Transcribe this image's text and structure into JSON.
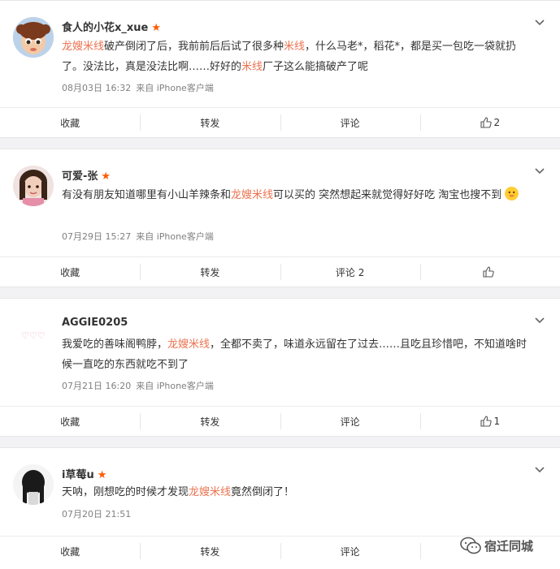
{
  "colors": {
    "highlight": "#eb7350",
    "star": "#ff5a00",
    "meta": "#808080"
  },
  "posts": [
    {
      "username": "食人的小花x_xue",
      "content": [
        {
          "t": "龙嫂米线",
          "hl": true
        },
        {
          "t": "破产倒闭了后，我前前后后试了很多种"
        },
        {
          "t": "米线",
          "hl": true
        },
        {
          "t": "，什么马老*，稻花*，都是买一包吃一袋就扔了。没法比，真是没法比啊……好好的"
        },
        {
          "t": "米线",
          "hl": true
        },
        {
          "t": "厂子这么能搞破产了呢"
        }
      ],
      "date": "08月03日 16:32",
      "source": "来自 iPhone客户端",
      "actions": {
        "collect": "收藏",
        "forward": "转发",
        "comment": "评论",
        "like_count": "2"
      }
    },
    {
      "username": "可爱-张",
      "content": [
        {
          "t": "有没有朋友知道哪里有小山羊辣条和"
        },
        {
          "t": "龙嫂米线",
          "hl": true
        },
        {
          "t": "可以买的 突然想起来就觉得好好吃 淘宝也搜不到 "
        }
      ],
      "emoji": "smile-emoji",
      "date": "07月29日 15:27",
      "source": "来自 iPhone客户端",
      "actions": {
        "collect": "收藏",
        "forward": "转发",
        "comment": "评论 2",
        "like_count": ""
      }
    },
    {
      "username": "AGGIE0205",
      "content": [
        {
          "t": "我爱吃的善味阁鸭脖，"
        },
        {
          "t": "龙嫂米线",
          "hl": true
        },
        {
          "t": "，全都不卖了，味道永远留在了过去……且吃且珍惜吧，不知道啥时候一直吃的东西就吃不到了"
        }
      ],
      "date": "07月21日 16:20",
      "source": "来自 iPhone客户端",
      "actions": {
        "collect": "收藏",
        "forward": "转发",
        "comment": "评论",
        "like_count": "1"
      }
    },
    {
      "username": "i草莓u",
      "content": [
        {
          "t": "天呐，刚想吃的时候才发现"
        },
        {
          "t": "龙嫂米线",
          "hl": true
        },
        {
          "t": "竟然倒闭了！"
        }
      ],
      "date": "07月20日 21:51",
      "source": "",
      "actions": {
        "collect": "收藏",
        "forward": "转发",
        "comment": "评论",
        "like_count": ""
      }
    }
  ],
  "watermark": {
    "text": "宿迁同城"
  }
}
